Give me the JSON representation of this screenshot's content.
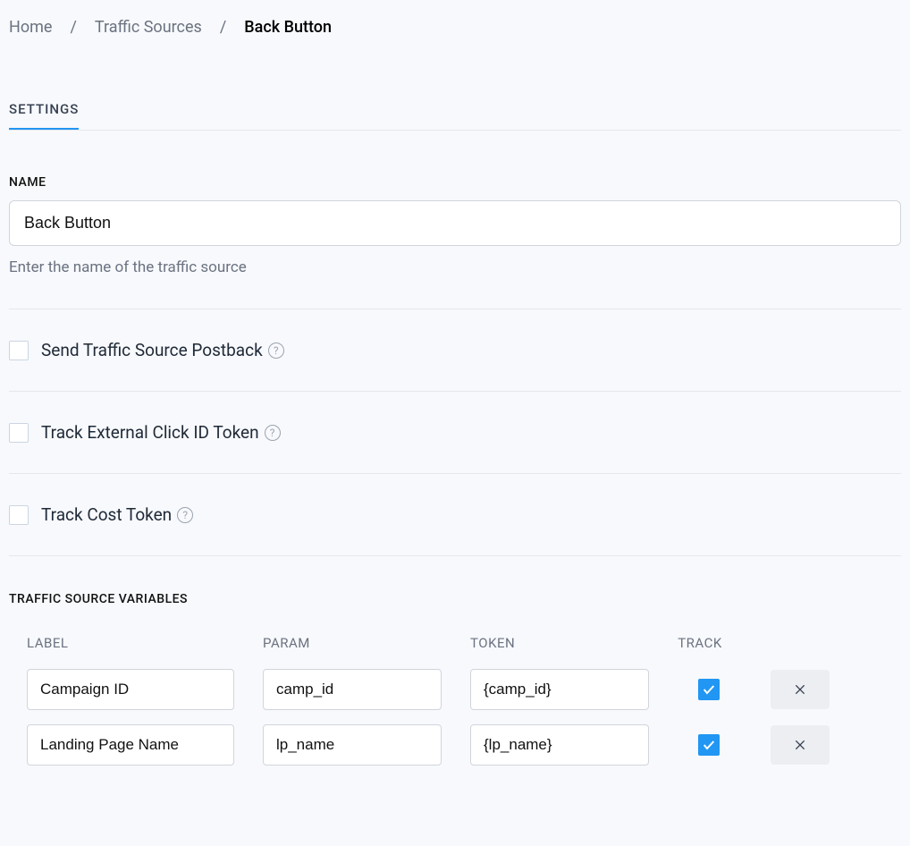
{
  "breadcrumb": {
    "items": [
      {
        "label": "Home",
        "current": false
      },
      {
        "label": "Traffic Sources",
        "current": false
      },
      {
        "label": "Back Button",
        "current": true
      }
    ],
    "separator": "/"
  },
  "tabs": {
    "settings": "SETTINGS"
  },
  "name_field": {
    "label": "NAME",
    "value": "Back Button",
    "hint": "Enter the name of the traffic source"
  },
  "options": {
    "postback": {
      "label": "Send Traffic Source Postback",
      "checked": false
    },
    "external_click": {
      "label": "Track External Click ID Token",
      "checked": false
    },
    "cost_token": {
      "label": "Track Cost Token",
      "checked": false
    }
  },
  "variables": {
    "heading": "TRAFFIC SOURCE VARIABLES",
    "columns": {
      "label": "LABEL",
      "param": "PARAM",
      "token": "TOKEN",
      "track": "TRACK"
    },
    "rows": [
      {
        "label": "Campaign ID",
        "param": "camp_id",
        "token": "{camp_id}",
        "track": true
      },
      {
        "label": "Landing Page Name",
        "param": "lp_name",
        "token": "{lp_name}",
        "track": true
      }
    ]
  }
}
